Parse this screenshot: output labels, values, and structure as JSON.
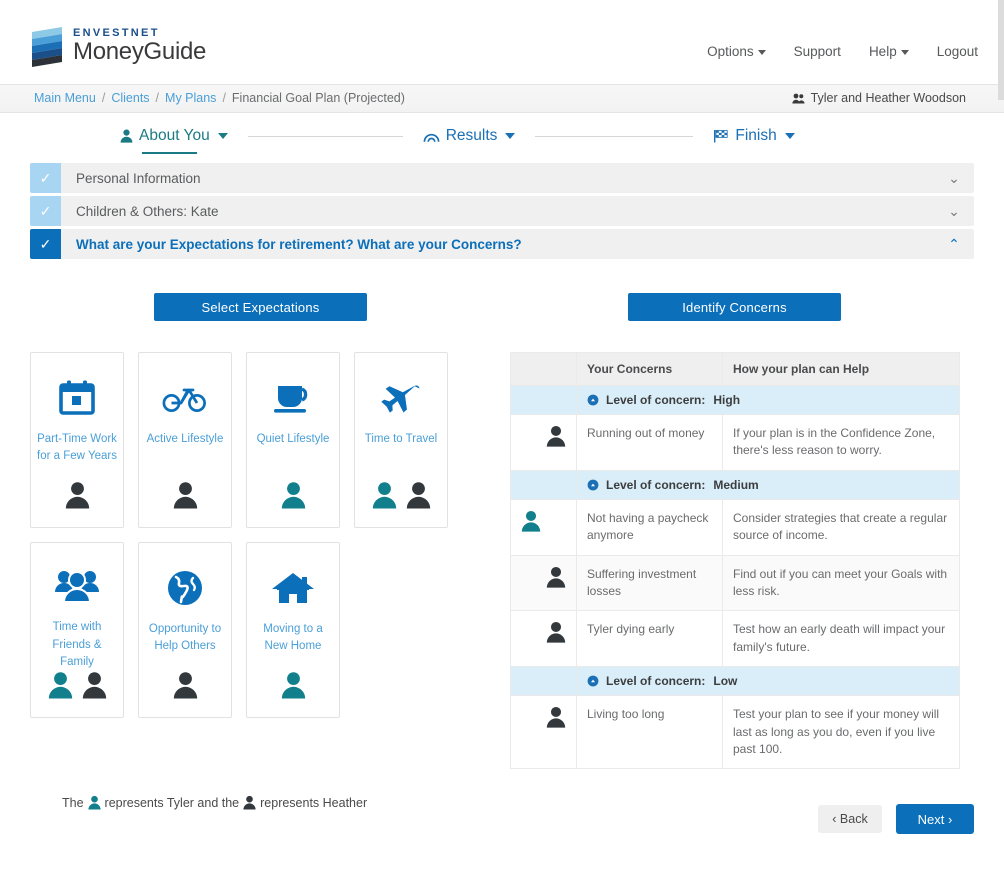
{
  "brand": {
    "envestnet": "ENVESTNET",
    "money": "Money",
    "guide": "Guide",
    "logo_colors": [
      "#8ecae6",
      "#4a9fd8",
      "#1a6fb5",
      "#1b4f8a",
      "#2c3237"
    ]
  },
  "topnav": {
    "items": [
      {
        "label": "Options",
        "caret": true
      },
      {
        "label": "Support",
        "caret": false
      },
      {
        "label": "Help",
        "caret": true
      },
      {
        "label": "Logout",
        "caret": false
      }
    ]
  },
  "breadcrumb": {
    "links": [
      "Main Menu",
      "Clients",
      "My Plans"
    ],
    "current": "Financial Goal Plan (Projected)",
    "separator": "/",
    "client": "Tyler and Heather Woodson",
    "link_color": "#4a9fd8"
  },
  "stepper": {
    "steps": [
      {
        "label": "About You",
        "icon": "person-icon",
        "active": true,
        "color": "#1b7b85"
      },
      {
        "label": "Results",
        "icon": "arch-icon",
        "active": false,
        "color": "#1a6fb5"
      },
      {
        "label": "Finish",
        "icon": "checkered-flag-icon",
        "active": false,
        "color": "#1a6fb5"
      }
    ]
  },
  "accordions": [
    {
      "label": "Personal Information",
      "checked": "light",
      "expanded": false,
      "chevron": "chevron-down-icon"
    },
    {
      "label": "Children & Others:  Kate",
      "checked": "light",
      "expanded": false,
      "chevron": "chevron-down-icon"
    },
    {
      "label": "What are your Expectations for retirement? What are your Concerns?",
      "checked": "solid",
      "expanded": true,
      "chevron": "chevron-up-icon"
    }
  ],
  "expectations": {
    "button_label": "Select Expectations",
    "cards": [
      {
        "label": "Part-Time Work for a Few Years",
        "icon": "calendar-icon",
        "people": [
          "heather"
        ]
      },
      {
        "label": "Active Lifestyle",
        "icon": "bicycle-icon",
        "people": [
          "heather"
        ]
      },
      {
        "label": "Quiet Lifestyle",
        "icon": "coffee-cup-icon",
        "people": [
          "tyler"
        ]
      },
      {
        "label": "Time to Travel",
        "icon": "airplane-icon",
        "people": [
          "tyler",
          "heather"
        ]
      },
      {
        "label": "Time with Friends & Family",
        "icon": "people-group-icon",
        "people": [
          "tyler",
          "heather"
        ]
      },
      {
        "label": "Opportunity to Help Others",
        "icon": "globe-icon",
        "people": [
          "heather"
        ]
      },
      {
        "label": "Moving to a New Home",
        "icon": "house-icon",
        "people": [
          "tyler"
        ]
      }
    ]
  },
  "concerns": {
    "button_label": "Identify Concerns",
    "headers": {
      "icon": "",
      "concern": "Your Concerns",
      "help": "How your plan can Help"
    },
    "level_prefix": "Level of concern:",
    "groups": [
      {
        "level": "High",
        "rows": [
          {
            "person": "heather",
            "concern": "Running out of money",
            "help": "If your plan is in the Confidence Zone, there's less reason to worry.",
            "shade": false
          }
        ]
      },
      {
        "level": "Medium",
        "rows": [
          {
            "person": "tyler",
            "concern": "Not having a paycheck anymore",
            "help": "Consider strategies that create a regular source of income.",
            "shade": false
          },
          {
            "person": "heather",
            "concern": "Suffering investment losses",
            "help": "Find out if you can meet your Goals with less risk.",
            "shade": true
          },
          {
            "person": "heather",
            "concern": "Tyler dying early",
            "help": "Test how an early death will impact your family's future.",
            "shade": false
          }
        ]
      },
      {
        "level": "Low",
        "rows": [
          {
            "person": "heather",
            "concern": "Living too long",
            "help": "Test your plan to see if your money will last as long as you do, even if you live past 100.",
            "shade": false
          }
        ]
      }
    ]
  },
  "legend": {
    "prefix": "The",
    "mid": "represents Tyler and the",
    "suffix": "represents Heather",
    "tyler_color": "#12808c",
    "heather_color": "#33383d"
  },
  "footer": {
    "back_label": "Back",
    "next_label": "Next",
    "back_chevron": "‹",
    "next_chevron": "›"
  },
  "theme": {
    "primary_blue": "#0b6fba",
    "link_blue": "#4a9fd8",
    "teal": "#1b7b85",
    "level_row_bg": "#daeef9"
  }
}
